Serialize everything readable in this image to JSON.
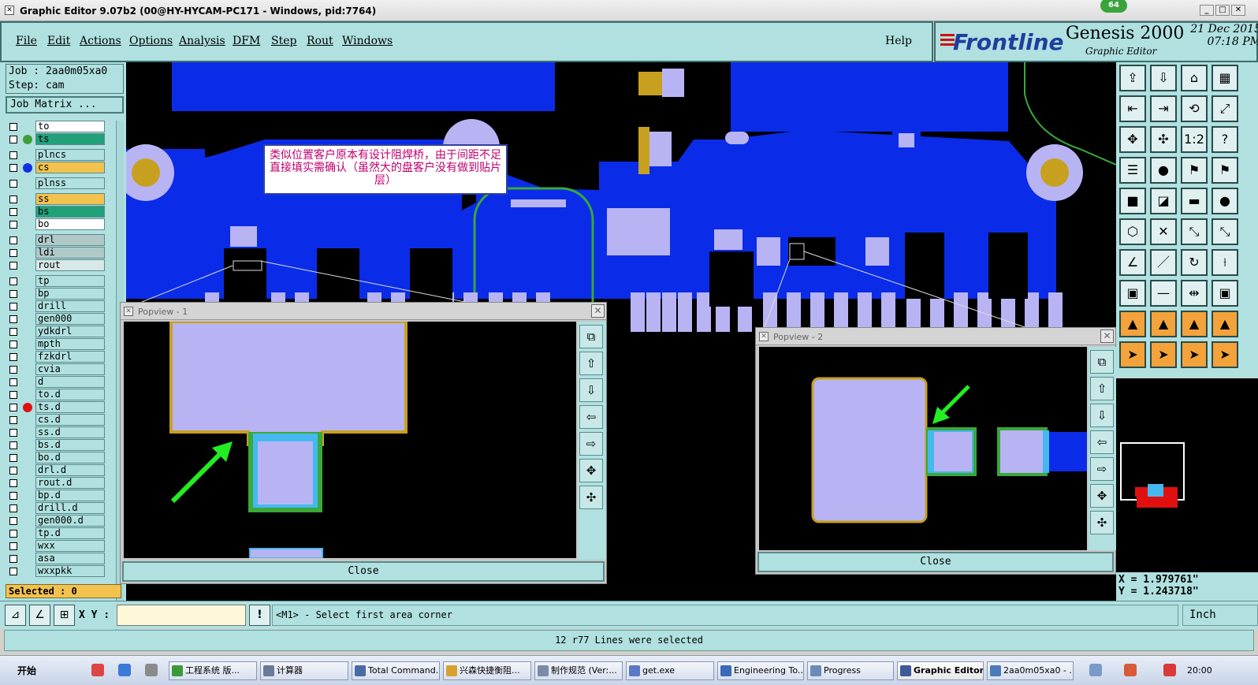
{
  "window": {
    "title": "Graphic Editor 9.07b2 (00@HY-HYCAM-PC171 - Windows, pid:7764)",
    "badge": "64"
  },
  "menu": [
    "File",
    "Edit",
    "Actions",
    "Options",
    "Analysis",
    "DFM",
    "Step",
    "Rout",
    "Windows"
  ],
  "help_label": "Help",
  "brand": {
    "logo": "Frontline",
    "product": "Genesis 2000",
    "subtitle": "Graphic Editor",
    "date": "21 Dec 2015",
    "time": "07:18 PM"
  },
  "job": {
    "job_line": "Job : 2aa0m05xa0",
    "step_line": "Step: cam",
    "matrix_button": "Job Matrix ..."
  },
  "layers": [
    {
      "name": "to",
      "color": "#ffffff",
      "dot": ""
    },
    {
      "name": "ts",
      "color": "#22a07a",
      "dot": "#3da036"
    },
    {
      "name": "plncs",
      "color": "#b0e0e0",
      "dot": ""
    },
    {
      "name": "cs",
      "color": "#f3c24e",
      "dot": "#1030e0"
    },
    {
      "name": "plnss",
      "color": "#b0e0e0",
      "dot": ""
    },
    {
      "name": "ss",
      "color": "#f3c24e",
      "dot": ""
    },
    {
      "name": "bs",
      "color": "#22a07a",
      "dot": ""
    },
    {
      "name": "bo",
      "color": "#ffffff",
      "dot": ""
    },
    {
      "name": "drl",
      "color": "#b0c8c8",
      "dot": ""
    },
    {
      "name": "ldi",
      "color": "#b0c8c8",
      "dot": ""
    },
    {
      "name": "rout",
      "color": "#d8e8e8",
      "dot": ""
    },
    {
      "name": "tp",
      "color": "#b0e0e0",
      "dot": ""
    },
    {
      "name": "bp",
      "color": "#b0e0e0",
      "dot": ""
    },
    {
      "name": "drill",
      "color": "#b0e0e0",
      "dot": ""
    },
    {
      "name": "gen000",
      "color": "#b0e0e0",
      "dot": ""
    },
    {
      "name": "ydkdrl",
      "color": "#b0e0e0",
      "dot": ""
    },
    {
      "name": "mpth",
      "color": "#b0e0e0",
      "dot": ""
    },
    {
      "name": "fzkdrl",
      "color": "#b0e0e0",
      "dot": ""
    },
    {
      "name": "cvia",
      "color": "#b0e0e0",
      "dot": ""
    },
    {
      "name": "d",
      "color": "#b0e0e0",
      "dot": ""
    },
    {
      "name": "to.d",
      "color": "#b0e0e0",
      "dot": ""
    },
    {
      "name": "ts.d",
      "color": "#b0e0e0",
      "dot": "#e01010"
    },
    {
      "name": "cs.d",
      "color": "#b0e0e0",
      "dot": ""
    },
    {
      "name": "ss.d",
      "color": "#b0e0e0",
      "dot": ""
    },
    {
      "name": "bs.d",
      "color": "#b0e0e0",
      "dot": ""
    },
    {
      "name": "bo.d",
      "color": "#b0e0e0",
      "dot": ""
    },
    {
      "name": "drl.d",
      "color": "#b0e0e0",
      "dot": ""
    },
    {
      "name": "rout.d",
      "color": "#b0e0e0",
      "dot": ""
    },
    {
      "name": "bp.d",
      "color": "#b0e0e0",
      "dot": ""
    },
    {
      "name": "drill.d",
      "color": "#b0e0e0",
      "dot": ""
    },
    {
      "name": "gen000.d",
      "color": "#b0e0e0",
      "dot": ""
    },
    {
      "name": "tp.d",
      "color": "#b0e0e0",
      "dot": ""
    },
    {
      "name": "wxx",
      "color": "#b0e0e0",
      "dot": ""
    },
    {
      "name": "asa",
      "color": "#b0e0e0",
      "dot": ""
    },
    {
      "name": "wxxpkk",
      "color": "#b0e0e0",
      "dot": ""
    }
  ],
  "selected_label": "Selected : 0",
  "annotation": "类似位置客户原本有设计阻焊桥，由于间距不足直接填实需确认（虽然大的盘客户没有做到贴片层）",
  "popview1": {
    "title": "Popview - 1",
    "close": "Close"
  },
  "popview2": {
    "title": "Popview - 2",
    "close": "Close"
  },
  "coords": {
    "x": "X = 1.979761\"",
    "y": "Y = 1.243718\""
  },
  "command": {
    "xy_label": "X Y :",
    "xy_value": "",
    "prompt": "<M1> - Select first area corner",
    "units": "Inch"
  },
  "status": "12 r77 Lines were selected",
  "taskbar": {
    "start": "开始",
    "items": [
      "工程系统  版...",
      "计算器",
      "Total Command...",
      "兴森快捷衡阻...",
      "制作规范 (Ver:...",
      "get.exe",
      "Engineering To...",
      "Progress",
      "Graphic Editor...",
      "2aa0m05xa0 - ..."
    ],
    "active": "Graphic Editor...",
    "clock": "20:00"
  },
  "colors": {
    "copper": "#0a2ce8",
    "pad": "#b8b4f4",
    "mask_edge": "#c8a020",
    "bridge": "#3aa83a",
    "panel": "#b0e0e0"
  }
}
